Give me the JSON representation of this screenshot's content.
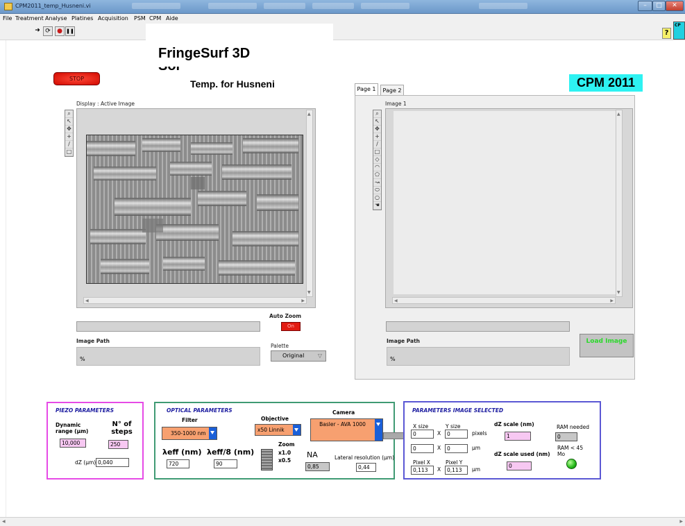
{
  "window": {
    "title": "CPM2011_temp_Husneni.vi",
    "min": "–",
    "max": "□",
    "close": "✕"
  },
  "menu": [
    "File",
    "Treatment",
    "Analyse",
    "Platines",
    "Acquisition",
    "PSM",
    "CPM",
    "Aide"
  ],
  "toolbar": {
    "run_glyph": "➜",
    "cont_glyph": "⟳",
    "abort_glyph": "●",
    "pause_glyph": "❚❚",
    "help_glyph": "?",
    "cyan_text": "CP"
  },
  "header": {
    "heading": "FringeSurf 3D",
    "heading_partial": "Sol",
    "subtitle": "Temp. for Husneni",
    "brand": "CPM 2011",
    "stop_label": "STOP"
  },
  "left_display": {
    "label": "Display : Active Image",
    "auto_zoom_label": "Auto Zoom",
    "auto_zoom_value": "On",
    "image_path_label": "Image Path",
    "image_path_value": "%",
    "palette_label": "Palette",
    "palette_value": "Original"
  },
  "right_display": {
    "tabs": [
      "Page 1",
      "Page 2"
    ],
    "label": "Image 1",
    "image_path_label": "Image Path",
    "image_path_value": "%",
    "load_label": "Load Image"
  },
  "piezo": {
    "title": "PIEZO PARAMETERS",
    "dynamic_range_label": "Dynamic range (µm)",
    "dynamic_range_value": "10,000",
    "steps_label": "N° of steps",
    "steps_value": "250",
    "dz_label": "dZ (µm)",
    "dz_value": "0,040"
  },
  "optical": {
    "title": "OPTICAL PARAMETERS",
    "filter_label": "Filter",
    "filter_value": "350-1000 nm",
    "objective_label": "Objective",
    "objective_value": "x50 Linnik",
    "camera_label": "Camera",
    "camera_value": "Basler - AVA 1000",
    "leff_label": "λeff (nm)",
    "leff_value": "720",
    "leff8_label": "λeff/8 (nm)",
    "leff8_value": "90",
    "zoom_label": "Zoom",
    "zoom_x1": "x1.0",
    "zoom_x05": "x0.5",
    "na_label": "NA",
    "na_value": "0,85",
    "lateral_label": "Lateral resolution (µm)",
    "lateral_value": "0,44"
  },
  "image_params": {
    "title": "PARAMETERS IMAGE SELECTED",
    "xsize_label": "X size",
    "ysize_label": "Y size",
    "xsize_value": "0",
    "ysize_value": "0",
    "pixels_unit": "pixels",
    "x_um_value": "0",
    "y_um_value": "0",
    "um_unit": "µm",
    "pixelx_label": "Pixel X",
    "pixely_label": "Pixel Y",
    "pixelx_value": "0,113",
    "pixely_value": "0,113",
    "times": "X",
    "dz_scale_label": "dZ scale (nm)",
    "dz_scale_value": "1",
    "dz_used_label": "dZ scale used (nm)",
    "dz_used_value": "0",
    "ram_label": "RAM needed",
    "ram_value": "0",
    "ram_limit_label": "RAM < 45 Mo"
  },
  "colors": {
    "piezo_border": "#e64ae6",
    "optical_border": "#3f9a73",
    "image_border": "#5a57d4",
    "brand_bg": "#2ef2f2",
    "stop_red": "#e01a10"
  }
}
